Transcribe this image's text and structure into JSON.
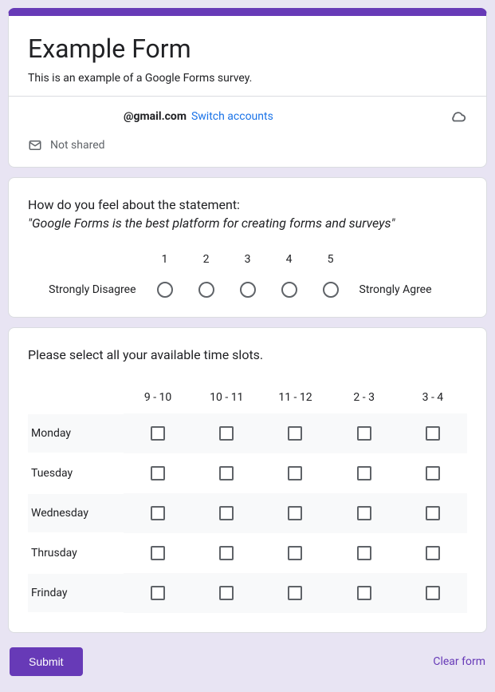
{
  "header": {
    "title": "Example Form",
    "description": "This is an example of a Google Forms survey.",
    "email_suffix": "@gmail.com",
    "switch_accounts": "Switch accounts",
    "not_shared": "Not shared"
  },
  "q1": {
    "prompt": "How do you feel about the statement:",
    "statement": "\"Google Forms is the best platform for creating forms and surveys\"",
    "scale": [
      "1",
      "2",
      "3",
      "4",
      "5"
    ],
    "left": "Strongly Disagree",
    "right": "Strongly Agree"
  },
  "q2": {
    "prompt": "Please select all your available time slots.",
    "cols": [
      "9 - 10",
      "10 - 11",
      "11 - 12",
      "2 - 3",
      "3 - 4"
    ],
    "rows": [
      "Monday",
      "Tuesday",
      "Wednesday",
      "Thrusday",
      "Frinday"
    ]
  },
  "footer": {
    "submit": "Submit",
    "clear": "Clear form"
  }
}
